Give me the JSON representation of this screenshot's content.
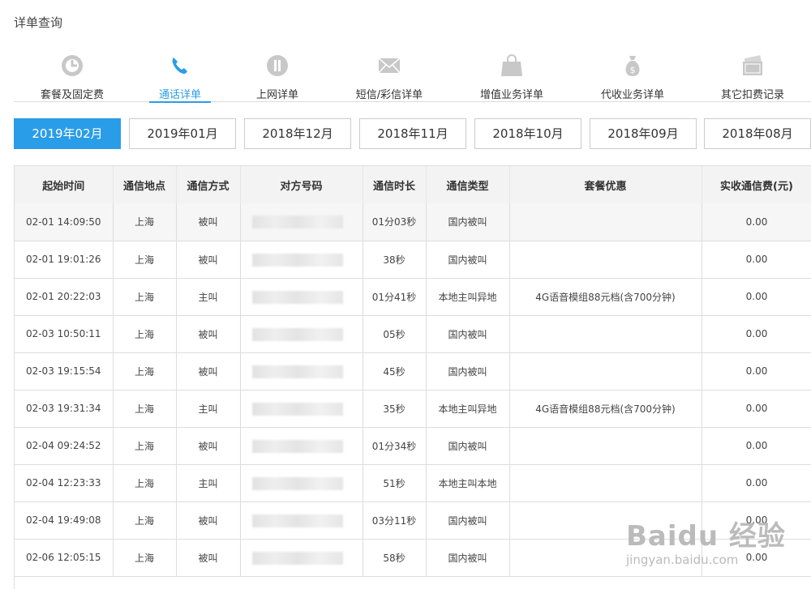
{
  "page": {
    "title": "详单查询"
  },
  "tabs": [
    {
      "label": "套餐及固定费",
      "icon": "clock-icon"
    },
    {
      "label": "通话详单",
      "icon": "phone-icon",
      "active": true
    },
    {
      "label": "上网详单",
      "icon": "network-icon"
    },
    {
      "label": "短信/彩信详单",
      "icon": "envelope-icon"
    },
    {
      "label": "增值业务详单",
      "icon": "shopping-bag-icon"
    },
    {
      "label": "代收业务详单",
      "icon": "money-bag-icon"
    },
    {
      "label": "其它扣费记录",
      "icon": "wallet-icon"
    }
  ],
  "months": [
    "2019年02月",
    "2019年01月",
    "2018年12月",
    "2018年11月",
    "2018年10月",
    "2018年09月",
    "2018年08月"
  ],
  "table": {
    "headers": [
      "起始时间",
      "通信地点",
      "通信方式",
      "对方号码",
      "通信时长",
      "通信类型",
      "套餐优惠",
      "实收通信费(元)"
    ],
    "rows": [
      {
        "time": "02-01 14:09:50",
        "place": "上海",
        "mode": "被叫",
        "number": "",
        "duration": "01分03秒",
        "type": "国内被叫",
        "discount": "",
        "fee": "0.00"
      },
      {
        "time": "02-01 19:01:26",
        "place": "上海",
        "mode": "被叫",
        "number": "",
        "duration": "38秒",
        "type": "国内被叫",
        "discount": "",
        "fee": "0.00"
      },
      {
        "time": "02-01 20:22:03",
        "place": "上海",
        "mode": "主叫",
        "number": "",
        "duration": "01分41秒",
        "type": "本地主叫异地",
        "discount": "4G语音模组88元档(含700分钟)",
        "fee": "0.00"
      },
      {
        "time": "02-03 10:50:11",
        "place": "上海",
        "mode": "被叫",
        "number": "",
        "duration": "05秒",
        "type": "国内被叫",
        "discount": "",
        "fee": "0.00"
      },
      {
        "time": "02-03 19:15:54",
        "place": "上海",
        "mode": "被叫",
        "number": "",
        "duration": "45秒",
        "type": "国内被叫",
        "discount": "",
        "fee": "0.00"
      },
      {
        "time": "02-03 19:31:34",
        "place": "上海",
        "mode": "主叫",
        "number": "",
        "duration": "35秒",
        "type": "本地主叫异地",
        "discount": "4G语音模组88元档(含700分钟)",
        "fee": "0.00"
      },
      {
        "time": "02-04 09:24:52",
        "place": "上海",
        "mode": "被叫",
        "number": "",
        "duration": "01分34秒",
        "type": "国内被叫",
        "discount": "",
        "fee": "0.00"
      },
      {
        "time": "02-04 12:23:33",
        "place": "上海",
        "mode": "主叫",
        "number": "",
        "duration": "51秒",
        "type": "本地主叫本地",
        "discount": "",
        "fee": "0.00"
      },
      {
        "time": "02-04 19:49:08",
        "place": "上海",
        "mode": "被叫",
        "number": "",
        "duration": "03分11秒",
        "type": "国内被叫",
        "discount": "",
        "fee": "0.00"
      },
      {
        "time": "02-06 12:05:15",
        "place": "上海",
        "mode": "被叫",
        "number": "",
        "duration": "58秒",
        "type": "国内被叫",
        "discount": "",
        "fee": "0.00"
      }
    ]
  },
  "watermark": {
    "text": "Baidu 经验",
    "sub": "jingyan.baidu.com"
  },
  "colors": {
    "accent": "#2a9de8",
    "icon": "#c8c8c8",
    "header_bg": "#f3f3f3"
  }
}
